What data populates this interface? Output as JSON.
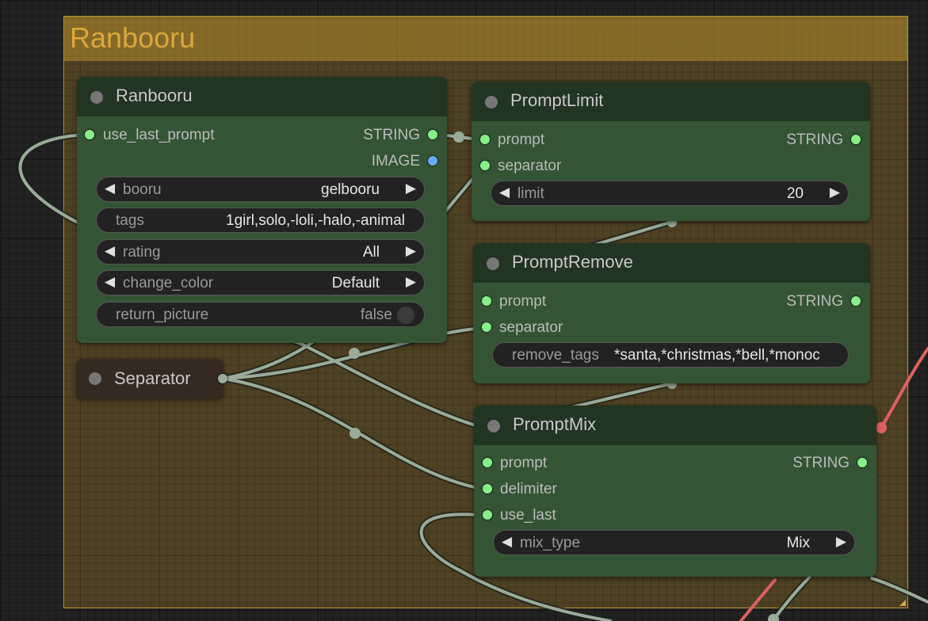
{
  "group": {
    "title": "Ranbooru",
    "color": "#d9a93a"
  },
  "nodes": {
    "ranbooru": {
      "title": "Ranbooru",
      "inputs": [
        {
          "name": "use_last_prompt"
        }
      ],
      "outputs": [
        {
          "name": "STRING"
        },
        {
          "name": "IMAGE"
        }
      ],
      "widgets": {
        "booru": {
          "name": "booru",
          "value": "gelbooru"
        },
        "tags": {
          "name": "tags",
          "value": "1girl,solo,-loli,-halo,-animal"
        },
        "rating": {
          "name": "rating",
          "value": "All"
        },
        "change_color": {
          "name": "change_color",
          "value": "Default"
        },
        "return_picture": {
          "name": "return_picture",
          "value": "false"
        }
      }
    },
    "separator": {
      "title": "Separator"
    },
    "prompt_limit": {
      "title": "PromptLimit",
      "inputs": [
        {
          "name": "prompt"
        },
        {
          "name": "separator"
        }
      ],
      "outputs": [
        {
          "name": "STRING"
        }
      ],
      "widgets": {
        "limit": {
          "name": "limit",
          "value": "20"
        }
      }
    },
    "prompt_remove": {
      "title": "PromptRemove",
      "inputs": [
        {
          "name": "prompt"
        },
        {
          "name": "separator"
        }
      ],
      "outputs": [
        {
          "name": "STRING"
        }
      ],
      "widgets": {
        "remove_tags": {
          "name": "remove_tags",
          "value": "*santa,*christmas,*bell,*monoc"
        }
      }
    },
    "prompt_mix": {
      "title": "PromptMix",
      "inputs": [
        {
          "name": "prompt"
        },
        {
          "name": "delimiter"
        },
        {
          "name": "use_last"
        }
      ],
      "outputs": [
        {
          "name": "STRING"
        }
      ],
      "widgets": {
        "mix_type": {
          "name": "mix_type",
          "value": "Mix"
        }
      }
    }
  },
  "colors": {
    "node_body": "#355435",
    "node_title": "#223422",
    "link": "#9aab9a",
    "string_slot": "#88ee88",
    "image_slot": "#6aaaf0",
    "red_link": "#e06060"
  },
  "icons": {
    "arrow_left": "◀",
    "arrow_right": "▶"
  }
}
